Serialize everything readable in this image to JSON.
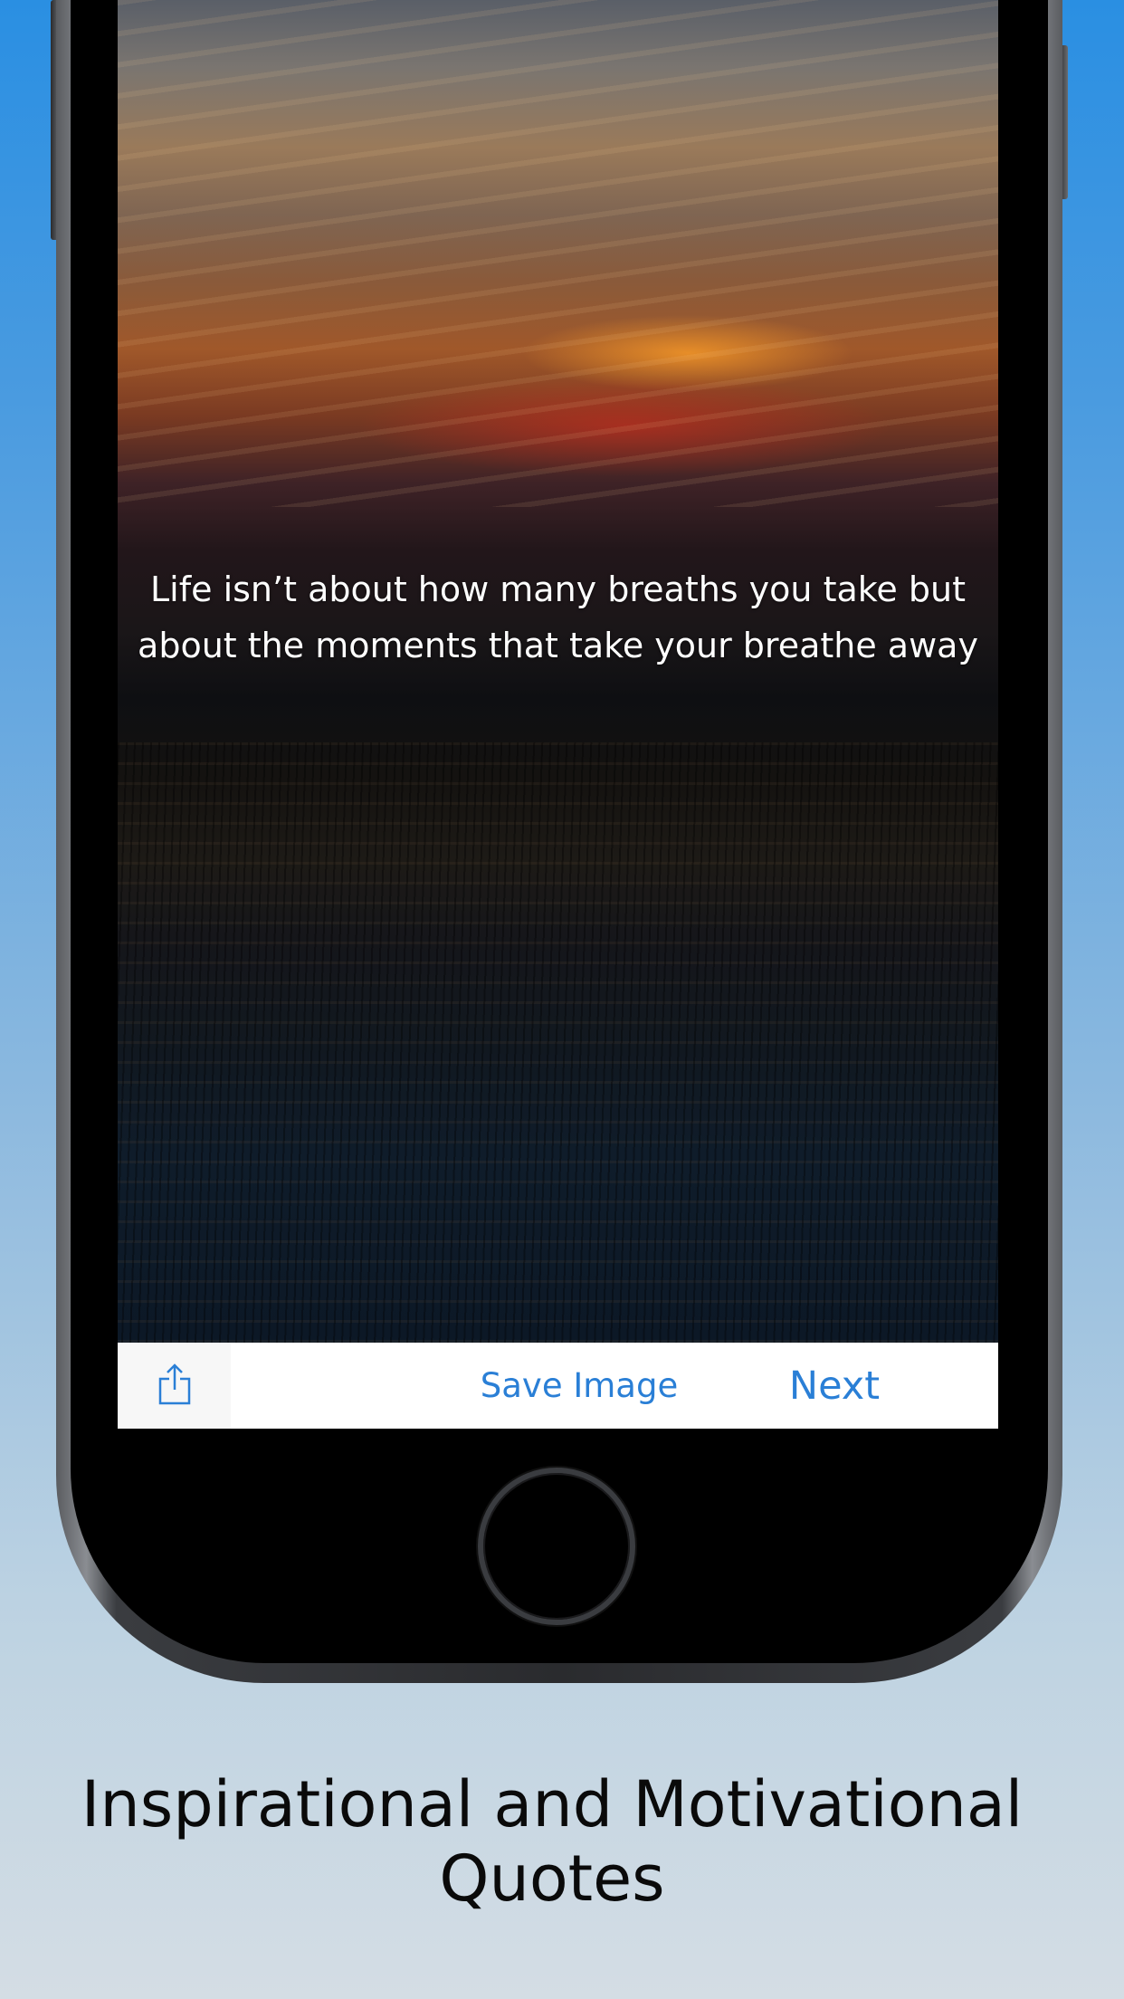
{
  "screen": {
    "quote_text": "Life isn’t about how many breaths you take but about the moments that take your breathe away"
  },
  "toolbar": {
    "share_icon": "share-icon",
    "save_label": "Save Image",
    "next_label": "Next",
    "accent_color": "#2a7fd6"
  },
  "caption": {
    "text": "Inspirational and Motivational Quotes"
  }
}
